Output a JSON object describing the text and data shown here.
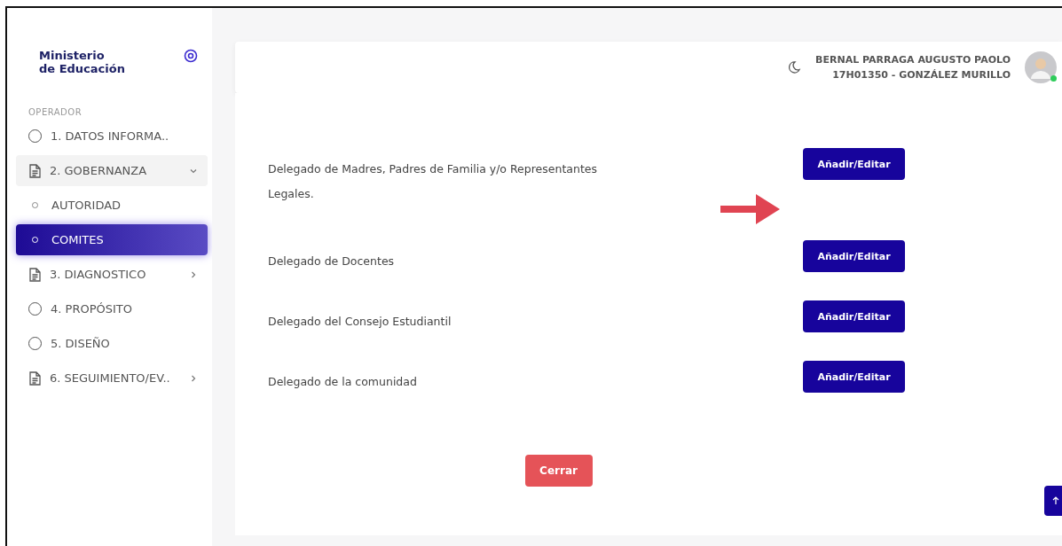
{
  "brand": {
    "line1": "Ministerio",
    "line2": "de Educación"
  },
  "sidebar": {
    "section": "OPERADOR",
    "items": [
      {
        "kind": "radio",
        "label": "1. DATOS INFORMA..",
        "selected": false
      },
      {
        "kind": "doc",
        "label": "2. GOBERNANZA",
        "selected": false,
        "expanded": true,
        "children": [
          {
            "kind": "sub",
            "label": "AUTORIDAD",
            "selected": false
          },
          {
            "kind": "sub",
            "label": "COMITES",
            "selected": true
          }
        ]
      },
      {
        "kind": "doc",
        "label": "3. DIAGNOSTICO",
        "selected": false,
        "expanded": false
      },
      {
        "kind": "radio",
        "label": "4. PROPÓSITO",
        "selected": false
      },
      {
        "kind": "radio",
        "label": "5. DISEÑO",
        "selected": false
      },
      {
        "kind": "doc",
        "label": "6. SEGUIMIENTO/EV..",
        "selected": false,
        "expanded": false
      }
    ]
  },
  "header": {
    "user_name": "BERNAL PARRAGA AUGUSTO PAOLO",
    "user_school": "17H01350 - GONZÁLEZ MURILLO",
    "online": true
  },
  "delegates": [
    {
      "label": "Delegado de Madres, Padres de Familia y/o Representantes Legales.",
      "button": "Añadir/Editar",
      "pointer": true
    },
    {
      "label": "Delegado de Docentes",
      "button": "Añadir/Editar",
      "pointer": false
    },
    {
      "label": "Delegado del Consejo Estudiantil",
      "button": "Añadir/Editar",
      "pointer": false
    },
    {
      "label": "Delegado de la comunidad",
      "button": "Añadir/Editar",
      "pointer": false
    }
  ],
  "close_button": "Cerrar"
}
